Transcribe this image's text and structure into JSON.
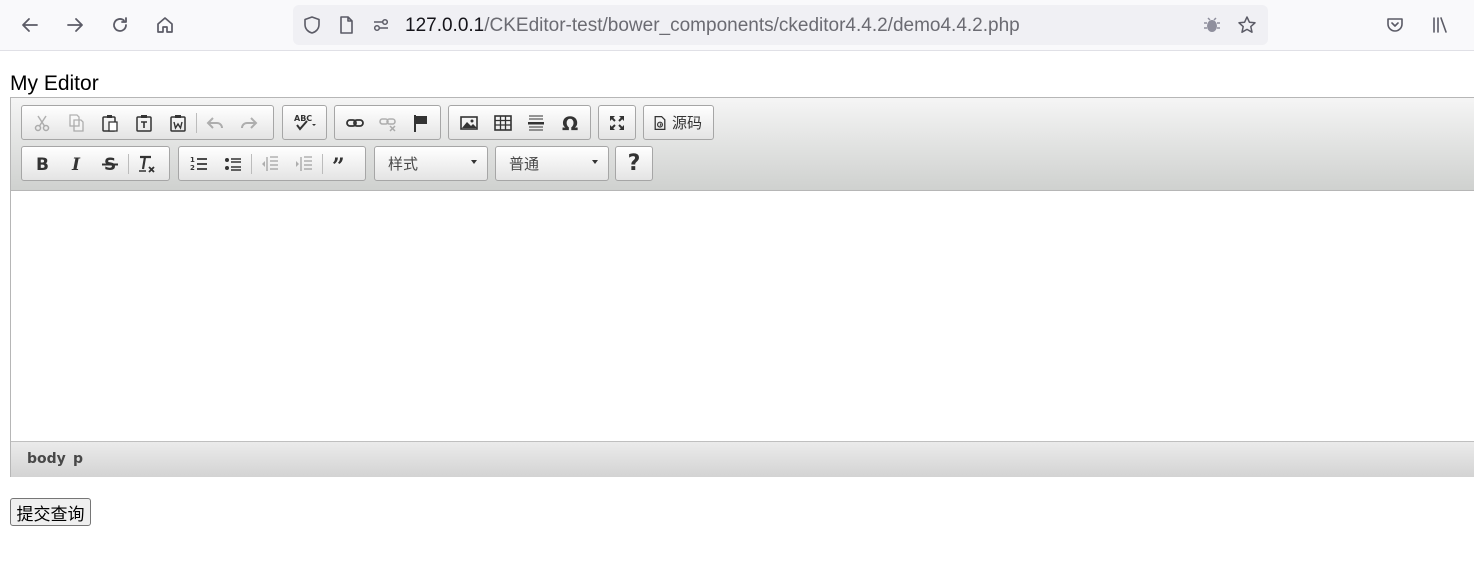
{
  "browser": {
    "url_host": "127.0.0.1",
    "url_path": "/CKEditor-test/bower_components/ckeditor4.4.2/demo4.4.2.php"
  },
  "page": {
    "heading": "My Editor",
    "submit_label": "提交查询"
  },
  "editor": {
    "source_label": "源码",
    "styles_combo": "样式",
    "format_combo": "普通",
    "help_label": "?",
    "elements_path": [
      "body",
      "p"
    ]
  },
  "colors": {
    "toolbar_top": "#f5f5f5",
    "toolbar_bottom": "#cfd1cf",
    "border": "#b6b6b6",
    "icon": "#333333"
  }
}
